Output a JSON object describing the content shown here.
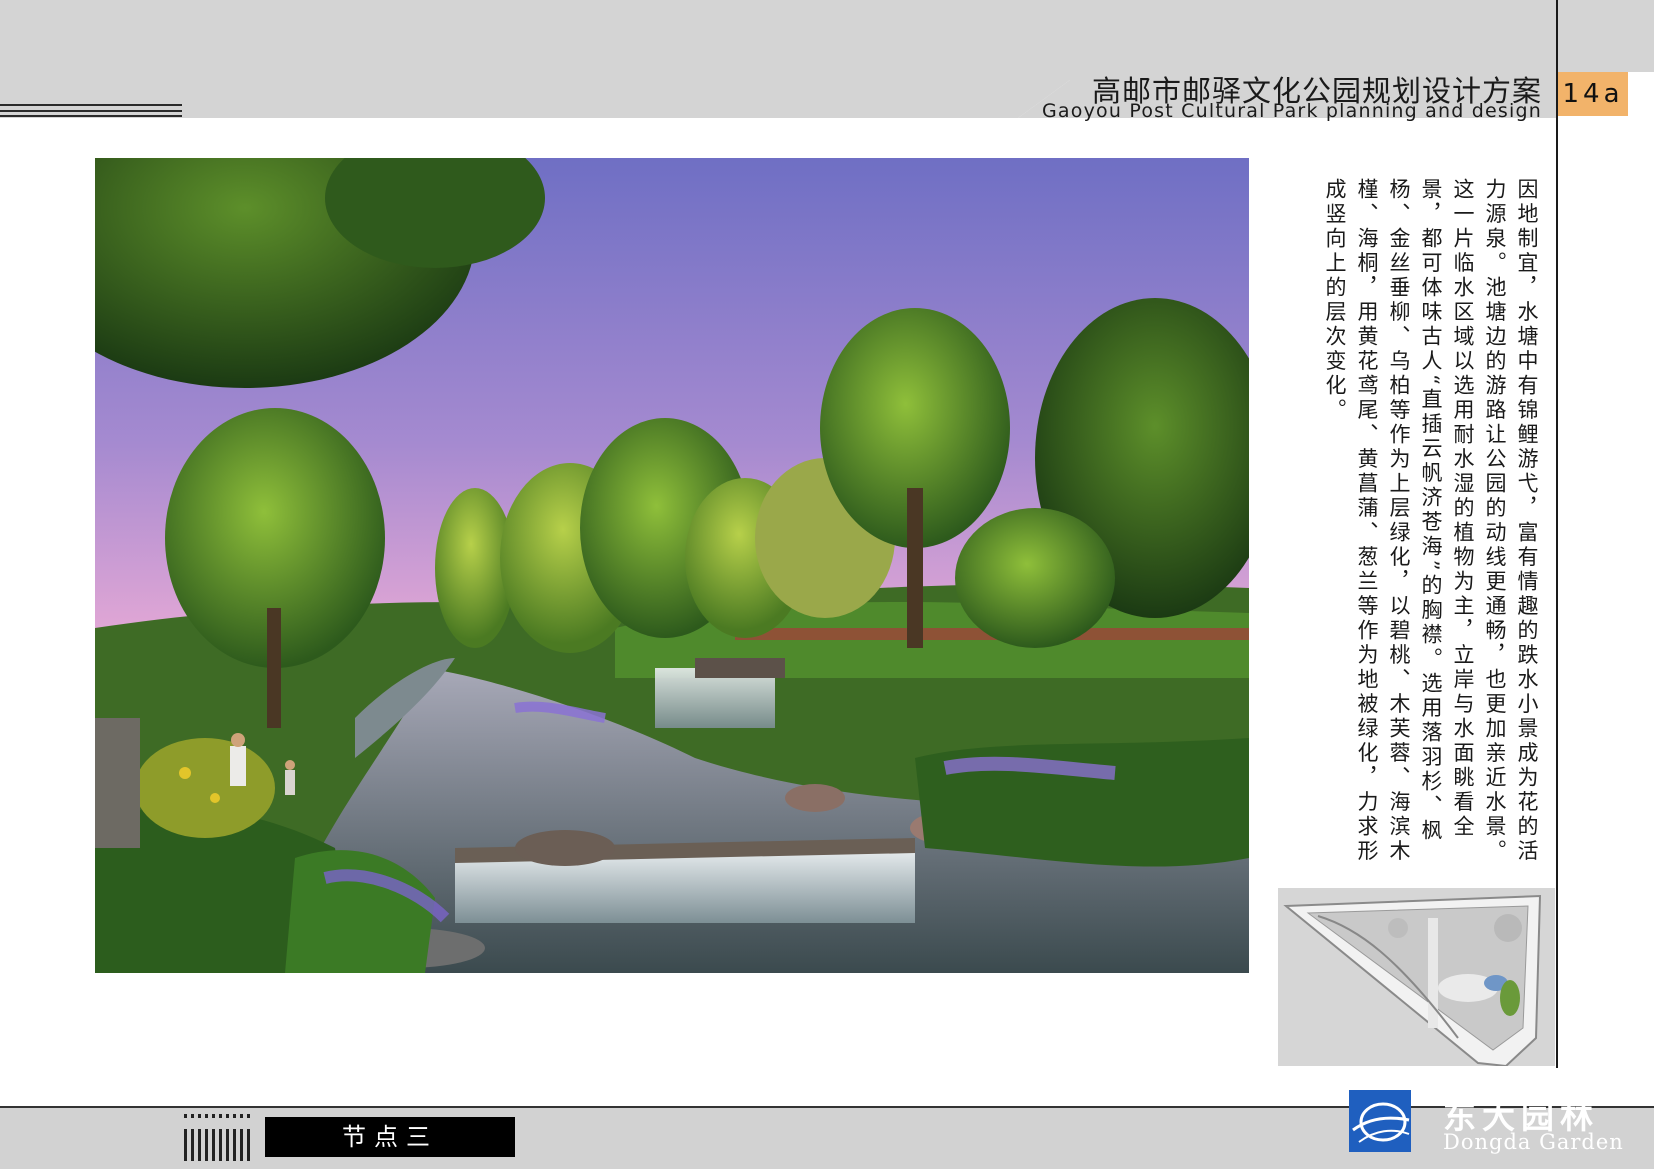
{
  "header": {
    "title_cn": "高邮市邮驿文化公园规划设计方案",
    "title_en": "Gaoyou Post Cultural Park planning and design",
    "page_number": "14a"
  },
  "description": "因地制宜，水塘中有锦鲤游弋，富有情趣的跌水小景成为花的活力源泉。池塘边的游路让公园的动线更通畅，也更加亲近水景。这一片临水区域以选用耐水湿的植物为主，立岸与水面眺看全景，都可体味古人“直插云帆济苍海”的胸襟。选用落羽杉、枫杨、金丝垂柳、乌柏等作为上层绿化，以碧桃、木芙蓉、海滨木槿、海桐，用黄花鸢尾、黄菖蒲、葱兰等作为地被绿化，力求形成竖向上的层次变化。",
  "footer": {
    "node_label": "节点三",
    "brand_cn": "东大园林",
    "brand_en": "Dongda Garden"
  },
  "colors": {
    "header_gray": "#d4d4d4",
    "page_tab": "#f2b36a",
    "logo_blue": "#1f5fbf"
  }
}
